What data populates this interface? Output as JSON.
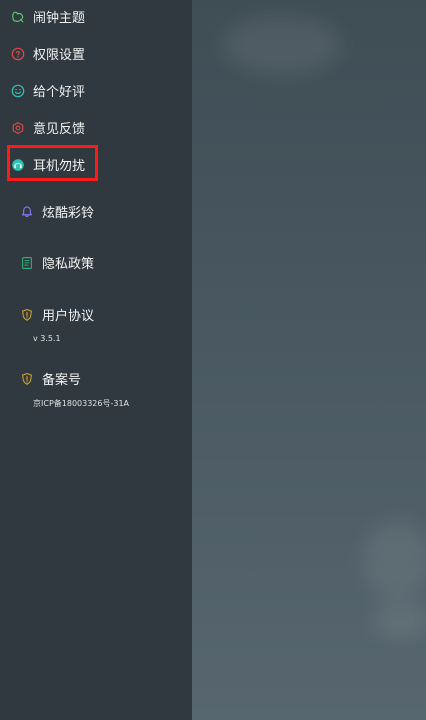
{
  "menu": {
    "items": [
      {
        "label": "闹钟主题",
        "icon": "theme-icon"
      },
      {
        "label": "权限设置",
        "icon": "question-icon"
      },
      {
        "label": "给个好评",
        "icon": "smile-icon"
      },
      {
        "label": "意见反馈",
        "icon": "feedback-icon"
      },
      {
        "label": "耳机勿扰",
        "icon": "headphone-icon"
      },
      {
        "label": "炫酷彩铃",
        "icon": "bell-icon"
      },
      {
        "label": "隐私政策",
        "icon": "document-icon"
      },
      {
        "label": "用户协议",
        "icon": "shield-icon"
      },
      {
        "label": "备案号",
        "icon": "shield-icon"
      }
    ],
    "version": "v 3.5.1",
    "record_number": "京ICP备18003326号-31A"
  },
  "colors": {
    "drawer_bg": "#30393f",
    "highlight": "#ff1a1a",
    "green": "#5bbf6a",
    "red": "#d94a4a",
    "teal": "#33c2b2",
    "purple": "#8d7cff",
    "gold": "#d4a12c"
  }
}
